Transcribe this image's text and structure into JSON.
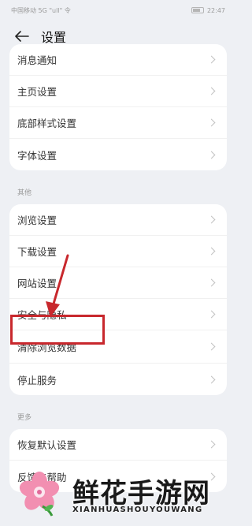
{
  "status": {
    "left_text": "中国移动 5G \"ull\" 令",
    "time": "22:47"
  },
  "header": {
    "title": "设置"
  },
  "group1": {
    "items": [
      {
        "label": "消息通知"
      },
      {
        "label": "主页设置"
      },
      {
        "label": "底部样式设置"
      },
      {
        "label": "字体设置"
      }
    ]
  },
  "group2": {
    "section_label": "其他",
    "items": [
      {
        "label": "浏览设置"
      },
      {
        "label": "下载设置"
      },
      {
        "label": "网站设置"
      },
      {
        "label": "安全与隐私"
      },
      {
        "label": "清除浏览数据"
      },
      {
        "label": "停止服务"
      }
    ]
  },
  "group3": {
    "section_label": "更多",
    "items": [
      {
        "label": "恢复默认设置"
      },
      {
        "label": "反馈与帮助"
      }
    ]
  },
  "watermark": {
    "title": "鲜花手游网",
    "subtitle": "XIANHUASHOUYOUWANG"
  },
  "colors": {
    "background": "#eef0f4",
    "card": "#ffffff",
    "highlight": "#c8282d"
  },
  "icons": [
    "back-arrow-icon",
    "chevron-right-icon",
    "battery-icon",
    "flower-logo-icon"
  ]
}
